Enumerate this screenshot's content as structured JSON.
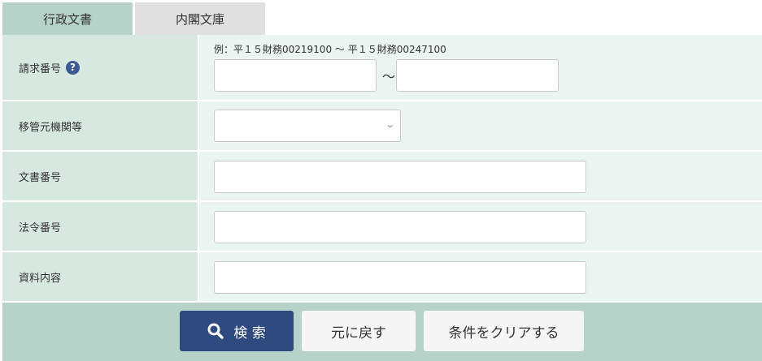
{
  "tabs": [
    {
      "label": "行政文書"
    },
    {
      "label": "内閣文庫"
    }
  ],
  "form": {
    "request_number": {
      "label": "請求番号",
      "help": "?",
      "example": "例：平１５財務00219100 ～ 平１５財務00247100",
      "from_value": "",
      "to_value": "",
      "separator": "～"
    },
    "transfer_agency": {
      "label": "移管元機関等",
      "selected": ""
    },
    "document_number": {
      "label": "文書番号",
      "value": ""
    },
    "law_number": {
      "label": "法令番号",
      "value": ""
    },
    "content": {
      "label": "資料内容",
      "value": ""
    }
  },
  "actions": {
    "search_label": "検 索",
    "back_label": "元に戻す",
    "clear_label": "条件をクリアする"
  },
  "colors": {
    "tab_active": "#b7d3c9",
    "tab_inactive": "#e0e0e0",
    "label_bg": "#d7e8e1",
    "field_bg": "#eaf4f0",
    "primary_button": "#2f4a7e",
    "help_icon": "#3a5a94"
  }
}
